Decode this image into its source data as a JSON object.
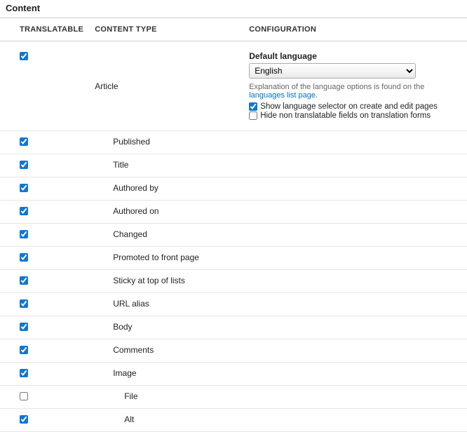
{
  "section_title": "Content",
  "headers": {
    "translatable": "TRANSLATABLE",
    "content_type": "CONTENT TYPE",
    "configuration": "CONFIGURATION"
  },
  "article_row": {
    "checked": true,
    "label": "Article",
    "config": {
      "default_language_label": "Default language",
      "default_language_value": "English",
      "explanation_prefix": "Explanation of the language options is found on the ",
      "explanation_link_text": "languages list page",
      "explanation_suffix": ".",
      "show_selector_label": "Show language selector on create and edit pages",
      "show_selector_checked": true,
      "hide_nontranslatable_label": "Hide non translatable fields on translation forms",
      "hide_nontranslatable_checked": false
    }
  },
  "fields": [
    {
      "label": "Published",
      "checked": true,
      "indent": 1
    },
    {
      "label": "Title",
      "checked": true,
      "indent": 1
    },
    {
      "label": "Authored by",
      "checked": true,
      "indent": 1
    },
    {
      "label": "Authored on",
      "checked": true,
      "indent": 1
    },
    {
      "label": "Changed",
      "checked": true,
      "indent": 1
    },
    {
      "label": "Promoted to front page",
      "checked": true,
      "indent": 1
    },
    {
      "label": "Sticky at top of lists",
      "checked": true,
      "indent": 1
    },
    {
      "label": "URL alias",
      "checked": true,
      "indent": 1
    },
    {
      "label": "Body",
      "checked": true,
      "indent": 1
    },
    {
      "label": "Comments",
      "checked": true,
      "indent": 1
    },
    {
      "label": "Image",
      "checked": true,
      "indent": 1
    },
    {
      "label": "File",
      "checked": false,
      "indent": 2
    },
    {
      "label": "Alt",
      "checked": true,
      "indent": 2
    }
  ]
}
